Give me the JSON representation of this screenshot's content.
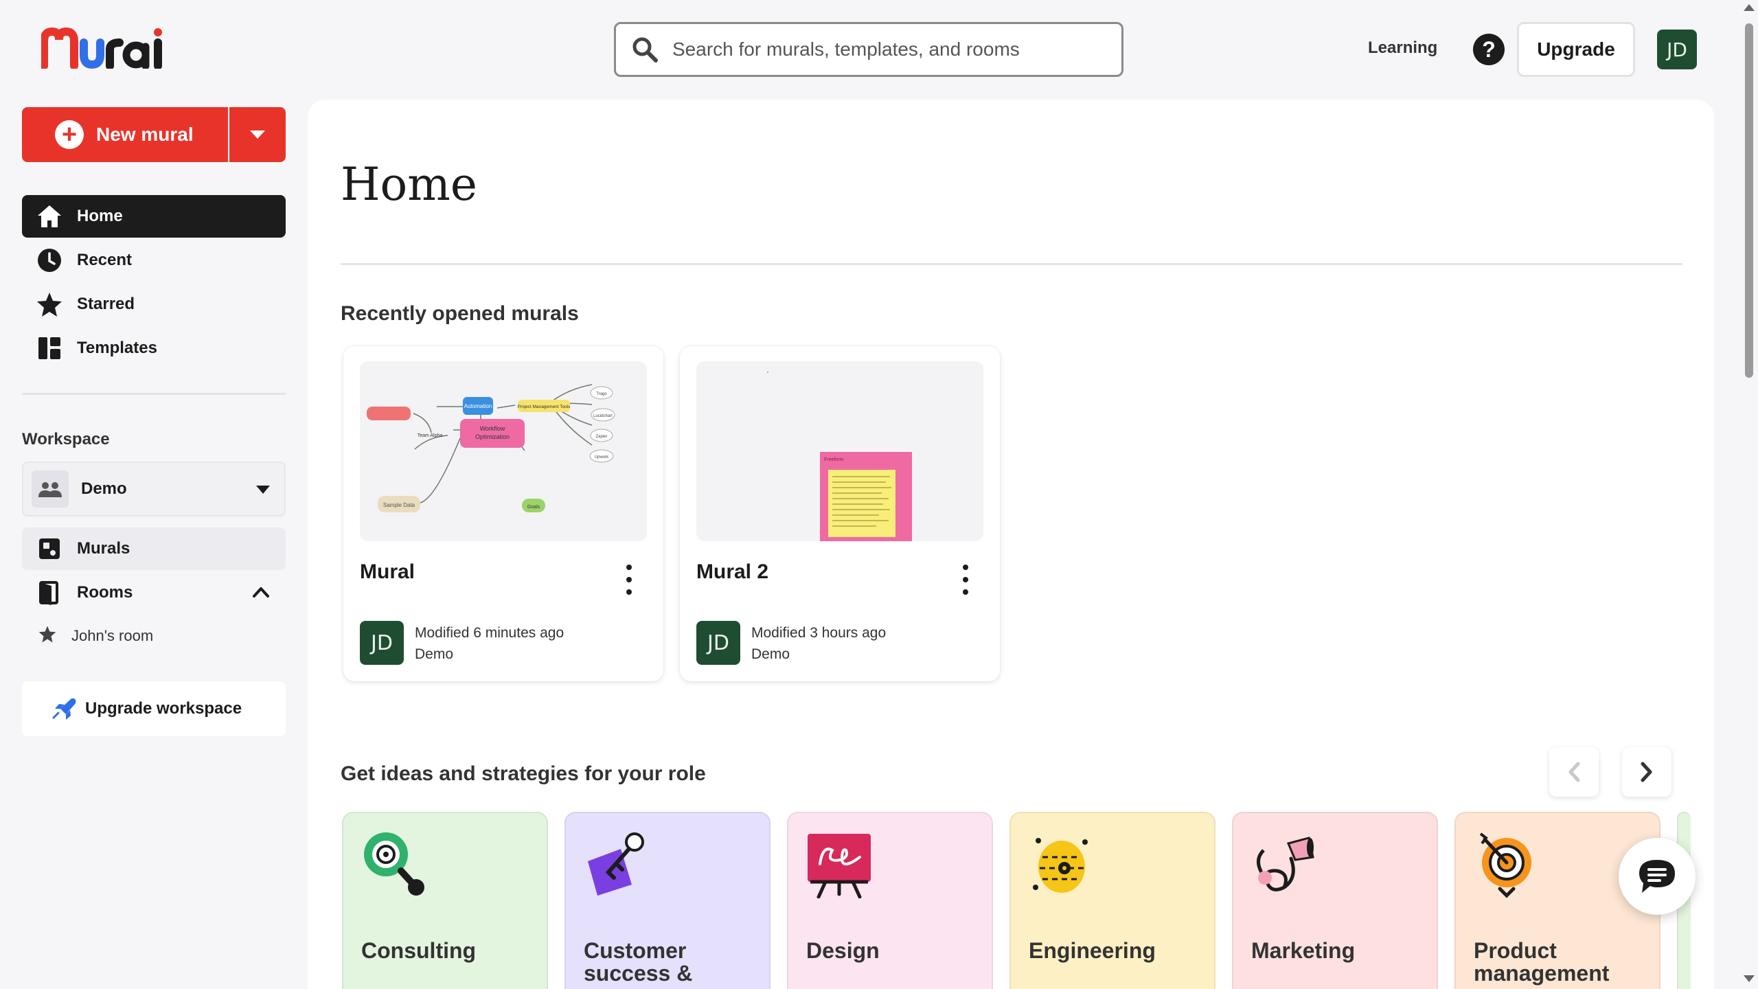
{
  "brand": {
    "logo_text": "Mural"
  },
  "search": {
    "placeholder": "Search for murals, templates, and rooms"
  },
  "header": {
    "learning_label": "Learning",
    "help_label": "?",
    "upgrade_label": "Upgrade",
    "user_initials": "JD"
  },
  "sidebar": {
    "new_mural_label": "New mural",
    "nav": [
      {
        "label": "Home",
        "icon": "home-icon",
        "active": true
      },
      {
        "label": "Recent",
        "icon": "clock-icon"
      },
      {
        "label": "Starred",
        "icon": "star-icon"
      },
      {
        "label": "Templates",
        "icon": "templates-icon"
      }
    ],
    "workspace_label": "Workspace",
    "workspace_name": "Demo",
    "murals_label": "Murals",
    "rooms_label": "Rooms",
    "rooms": [
      {
        "label": "John's room",
        "icon": "star-icon"
      }
    ],
    "upgrade_workspace_label": "Upgrade workspace"
  },
  "main": {
    "title": "Home",
    "recent_section_title": "Recently opened murals",
    "murals": [
      {
        "title": "Mural",
        "initials": "JD",
        "modified": "Modified 6 minutes ago",
        "workspace": "Demo"
      },
      {
        "title": "Mural 2",
        "initials": "JD",
        "modified": "Modified 3 hours ago",
        "workspace": "Demo"
      }
    ],
    "thumbnail_1": {
      "center": "Workflow Optimization",
      "automation": "Automation",
      "tools": "Project Management Tools",
      "team": "Team Alpha",
      "sample": "Sample Data",
      "goals": "Goals",
      "leaves": [
        "Trago",
        "Lucidchart",
        "Zapier",
        "Upwork"
      ]
    },
    "thumbnail_2": {
      "note_title": "Freeform"
    },
    "roles_section_title": "Get ideas and strategies for your role",
    "roles": [
      {
        "label": "Consulting",
        "color": "#e3f4df"
      },
      {
        "label": "Customer success &",
        "color": "#e5e0fb"
      },
      {
        "label": "Design",
        "color": "#fde4f1"
      },
      {
        "label": "Engineering",
        "color": "#fdf0c4"
      },
      {
        "label": "Marketing",
        "color": "#fde0df"
      },
      {
        "label": "Product management",
        "color": "#fde6d3"
      }
    ]
  },
  "colors": {
    "accent": "#e8332b",
    "dark": "#1c1c1c",
    "avatar": "#1f4d32"
  }
}
